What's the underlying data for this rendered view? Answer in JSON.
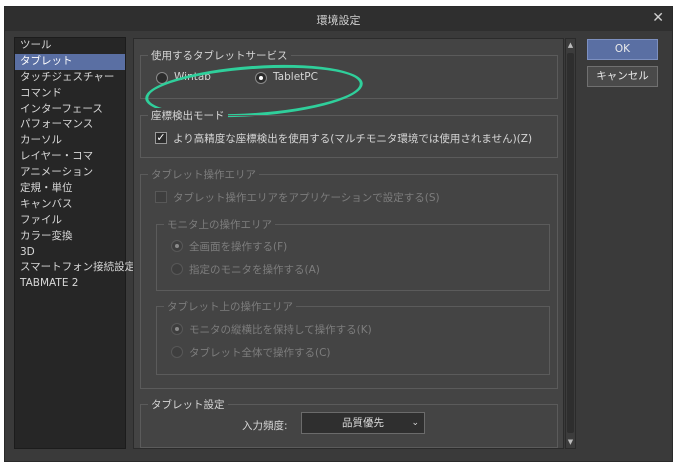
{
  "window": {
    "title": "環境設定"
  },
  "sidebar": {
    "items": [
      {
        "label": "ツール"
      },
      {
        "label": "タブレット",
        "selected": true
      },
      {
        "label": "タッチジェスチャー"
      },
      {
        "label": "コマンド"
      },
      {
        "label": "インターフェース"
      },
      {
        "label": "パフォーマンス"
      },
      {
        "label": "カーソル"
      },
      {
        "label": "レイヤー・コマ"
      },
      {
        "label": "アニメーション"
      },
      {
        "label": "定規・単位"
      },
      {
        "label": "キャンバス"
      },
      {
        "label": "ファイル"
      },
      {
        "label": "カラー変換"
      },
      {
        "label": "3D"
      },
      {
        "label": "スマートフォン接続設定"
      },
      {
        "label": "TABMATE 2"
      }
    ]
  },
  "tablet_service": {
    "legend": "使用するタブレットサービス",
    "wintab_label": "Wintab",
    "tabletpc_label": "TabletPC",
    "selected": "TabletPC",
    "highlight_color": "#2fcf9b"
  },
  "coordinate": {
    "legend": "座標検出モード",
    "checkbox_label": "より高精度な座標検出を使用する(マルチモニタ環境では使用されません)(Z)",
    "checked": true
  },
  "work_area": {
    "legend": "タブレット操作エリア",
    "app_setting_label": "タブレット操作エリアをアプリケーションで設定する(S)",
    "monitor_group": {
      "legend": "モニタ上の操作エリア",
      "option1": "全画面を操作する(F)",
      "option2": "指定のモニタを操作する(A)"
    },
    "tablet_group": {
      "legend": "タブレット上の操作エリア",
      "option1": "モニタの縦横比を保持して操作する(K)",
      "option2": "タブレット全体で操作する(C)"
    }
  },
  "tablet_settings": {
    "legend": "タブレット設定",
    "rate_label": "入力頻度:",
    "rate_value": "品質優先"
  },
  "buttons": {
    "ok": "OK",
    "cancel": "キャンセル"
  }
}
